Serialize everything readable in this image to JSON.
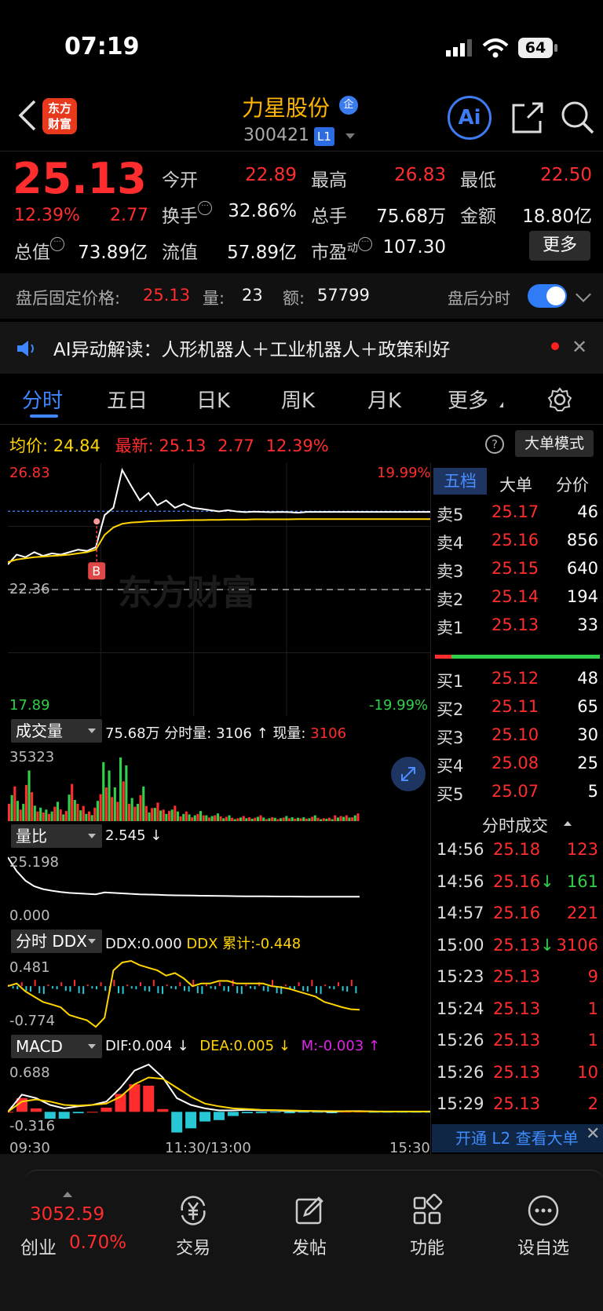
{
  "status": {
    "time": "07:19",
    "battery": "64"
  },
  "header": {
    "logo_line1": "东方",
    "logo_line2": "财富",
    "stock_name": "力星股份",
    "badge": "企",
    "stock_code": "300421",
    "level_badge": "L1",
    "ai_label": "Ai"
  },
  "quote": {
    "price": "25.13",
    "change_pct": "12.39%",
    "change": "2.77",
    "open_label": "今开",
    "open": "22.89",
    "high_label": "最高",
    "high": "26.83",
    "low_label": "最低",
    "low": "22.50",
    "turnover_label": "换手",
    "turnover": "32.86%",
    "volume_label": "总手",
    "volume": "75.68万",
    "amount_label": "金额",
    "amount": "18.80亿",
    "mktcap_label": "总值",
    "mktcap": "73.89亿",
    "float_label": "流值",
    "float": "57.89亿",
    "pe_label": "市盈",
    "pe_sup": "动",
    "pe": "107.30",
    "more": "更多"
  },
  "after_hours": {
    "label": "盘后固定价格:",
    "price": "25.13",
    "vol_label": "量:",
    "vol": "23",
    "amt_label": "额:",
    "amt": "57799",
    "toggle_label": "盘后分时"
  },
  "ai_banner": {
    "text": "AI异动解读：人形机器人＋工业机器人＋政策利好"
  },
  "tabs": [
    "分时",
    "五日",
    "日K",
    "周K",
    "月K",
    "更多"
  ],
  "avg_row": {
    "avg_label": "均价:",
    "avg": "24.84",
    "latest_label": "最新:",
    "latest": "25.13",
    "chg": "2.77",
    "pct": "12.39%",
    "mode_btn": "大单模式"
  },
  "chart_data": [
    {
      "type": "line",
      "title": "",
      "y_left_ticks": [
        "26.83",
        "22.36",
        "17.89"
      ],
      "y_right_ticks": [
        "19.99%",
        "-19.99%"
      ],
      "x_ticks": [
        "09:30",
        "11:30/13:00",
        "15:30"
      ],
      "ylim": [
        17.89,
        26.83
      ],
      "prev_close": 22.36,
      "marker_label": "B",
      "watermark": "东方财富",
      "series": [
        {
          "name": "price",
          "color": "#ffffff",
          "values": [
            23.0,
            23.4,
            23.3,
            23.5,
            23.35,
            23.45,
            23.4,
            23.5,
            23.6,
            23.55,
            23.7,
            25.0,
            25.3,
            26.83,
            26.2,
            25.6,
            25.9,
            25.4,
            25.6,
            25.3,
            25.45,
            25.3,
            25.25,
            25.2,
            25.15,
            25.2,
            25.15,
            25.12,
            25.14,
            25.13,
            25.12,
            25.13,
            25.12,
            25.1,
            25.13,
            25.13,
            25.13,
            25.13,
            25.13,
            25.13,
            25.13
          ]
        },
        {
          "name": "avg",
          "color": "#ffd400",
          "values": [
            23.1,
            23.2,
            23.25,
            23.3,
            23.32,
            23.35,
            23.37,
            23.4,
            23.45,
            23.5,
            23.6,
            24.2,
            24.5,
            24.65,
            24.7,
            24.72,
            24.75,
            24.76,
            24.77,
            24.78,
            24.79,
            24.8,
            24.8,
            24.81,
            24.81,
            24.82,
            24.82,
            24.82,
            24.83,
            24.83,
            24.83,
            24.83,
            24.83,
            24.84,
            24.84,
            24.84,
            24.84,
            24.84,
            24.84,
            24.84,
            24.84
          ]
        }
      ]
    },
    {
      "type": "bar",
      "title": "成交量",
      "y_top_tick": "35323",
      "values": [
        18,
        12,
        30,
        8,
        6,
        10,
        7,
        22,
        9,
        5,
        14,
        35,
        20,
        33,
        12,
        18,
        9,
        11,
        6,
        8,
        5,
        4,
        6,
        3,
        4,
        3,
        2,
        3,
        2,
        3,
        2,
        2,
        3,
        2,
        2,
        3,
        2,
        2,
        3,
        3,
        4
      ]
    },
    {
      "type": "line",
      "title": "量比",
      "y_ticks": [
        "25.198",
        "0.000"
      ],
      "values": [
        25.198,
        12,
        7,
        5,
        4.2,
        3.8,
        3.5,
        3.3,
        3.2,
        3.1,
        3.0,
        3.4,
        3.3,
        3.2,
        3.1,
        3.0,
        2.95,
        2.9,
        2.85,
        2.8,
        2.78,
        2.75,
        2.72,
        2.7,
        2.68,
        2.66,
        2.64,
        2.62,
        2.61,
        2.6,
        2.59,
        2.58,
        2.57,
        2.56,
        2.555,
        2.55,
        2.548,
        2.546,
        2.545,
        2.545,
        2.545
      ]
    },
    {
      "type": "line",
      "title": "分时 DDX",
      "y_ticks": [
        "0.481",
        "-0.774"
      ],
      "values": [
        0.0,
        0.05,
        -0.1,
        -0.2,
        -0.3,
        -0.35,
        -0.4,
        -0.55,
        -0.6,
        -0.65,
        -0.774,
        -0.6,
        0.3,
        0.45,
        0.481,
        0.4,
        0.35,
        0.3,
        0.2,
        0.25,
        0.15,
        0.0,
        0.05,
        0.05,
        0.1,
        0.1,
        0.05,
        0.05,
        0.05,
        0.05,
        0.0,
        -0.02,
        -0.05,
        -0.1,
        -0.15,
        -0.2,
        -0.3,
        -0.35,
        -0.4,
        -0.44,
        -0.448
      ]
    },
    {
      "type": "line",
      "title": "MACD",
      "y_ticks": [
        "0.688",
        "-0.316"
      ],
      "series": [
        {
          "name": "DIF",
          "color": "#ffffff",
          "values": [
            0.0,
            0.25,
            0.2,
            0.1,
            0.05,
            0.08,
            0.1,
            0.15,
            0.35,
            0.6,
            0.688,
            0.5,
            0.2,
            0.1,
            0.05,
            0.02,
            0.02,
            0.03,
            0.02,
            0.02,
            0.01,
            0.01,
            0.01,
            0.0,
            0.01,
            0.01,
            0.005,
            0.004,
            0.004,
            0.004,
            0.004
          ]
        },
        {
          "name": "DEA",
          "color": "#ffd400",
          "values": [
            0.0,
            0.15,
            0.18,
            0.15,
            0.1,
            0.09,
            0.1,
            0.12,
            0.22,
            0.4,
            0.5,
            0.48,
            0.35,
            0.22,
            0.12,
            0.08,
            0.05,
            0.04,
            0.03,
            0.025,
            0.02,
            0.015,
            0.012,
            0.01,
            0.009,
            0.008,
            0.006,
            0.005,
            0.005,
            0.005,
            0.005
          ]
        },
        {
          "name": "M",
          "color": "#e023e6",
          "values": [
            0.0,
            0.2,
            0.05,
            -0.1,
            -0.1,
            -0.02,
            0.0,
            0.06,
            0.26,
            0.4,
            0.38,
            0.04,
            -0.3,
            -0.24,
            -0.14,
            -0.12,
            -0.06,
            -0.02,
            -0.02,
            -0.01,
            -0.02,
            -0.01,
            -0.004,
            -0.02,
            0.002,
            0.004,
            -0.002,
            -0.002,
            -0.002,
            -0.002,
            -0.003
          ]
        }
      ]
    }
  ],
  "volume_info": {
    "label": "成交量",
    "total": "75.68万",
    "fs_label": "分时量:",
    "fs": "3106 ↑",
    "now_label": "现量:",
    "now": "3106"
  },
  "ratio_info": {
    "label": "量比",
    "value": "2.545 ↓"
  },
  "ddx_info": {
    "label": "分时 DDX",
    "ddx": "DDX:0.000",
    "cum": "DDX 累计:-0.448"
  },
  "macd_info": {
    "label": "MACD",
    "dif": "DIF:0.004 ↓",
    "dea": "DEA:0.005 ↓",
    "m": "M:-0.003 ↑"
  },
  "orderbook": {
    "tabs": [
      "五档",
      "大单",
      "分价"
    ],
    "asks": [
      {
        "label": "卖5",
        "price": "25.17",
        "vol": "46"
      },
      {
        "label": "卖4",
        "price": "25.16",
        "vol": "856"
      },
      {
        "label": "卖3",
        "price": "25.15",
        "vol": "640"
      },
      {
        "label": "卖2",
        "price": "25.14",
        "vol": "194"
      },
      {
        "label": "卖1",
        "price": "25.13",
        "vol": "33"
      }
    ],
    "bids": [
      {
        "label": "买1",
        "price": "25.12",
        "vol": "48"
      },
      {
        "label": "买2",
        "price": "25.11",
        "vol": "65"
      },
      {
        "label": "买3",
        "price": "25.10",
        "vol": "30"
      },
      {
        "label": "买4",
        "price": "25.08",
        "vol": "25"
      },
      {
        "label": "买5",
        "price": "25.07",
        "vol": "5"
      }
    ],
    "trades_title": "分时成交",
    "trades": [
      {
        "time": "14:56",
        "price": "25.18",
        "vol": "123",
        "color": "red"
      },
      {
        "time": "14:56",
        "price": "25.16↓",
        "vol": "161",
        "color": "green"
      },
      {
        "time": "14:57",
        "price": "25.16",
        "vol": "221",
        "color": "red"
      },
      {
        "time": "15:00",
        "price": "25.13↓",
        "vol": "3106",
        "color": "red"
      },
      {
        "time": "15:23",
        "price": "25.13",
        "vol": "9",
        "color": "red"
      },
      {
        "time": "15:24",
        "price": "25.13",
        "vol": "1",
        "color": "red"
      },
      {
        "time": "15:26",
        "price": "25.13",
        "vol": "1",
        "color": "red"
      },
      {
        "time": "15:26",
        "price": "25.13",
        "vol": "10",
        "color": "red"
      },
      {
        "time": "15:29",
        "price": "25.13",
        "vol": "2",
        "color": "red"
      }
    ],
    "l2_text": "开通 L2 查看大单"
  },
  "bottom": {
    "index_value": "3052.59",
    "index_name": "创业",
    "index_pct": "0.70%",
    "nav": [
      "交易",
      "发帖",
      "功能",
      "设自选"
    ]
  }
}
